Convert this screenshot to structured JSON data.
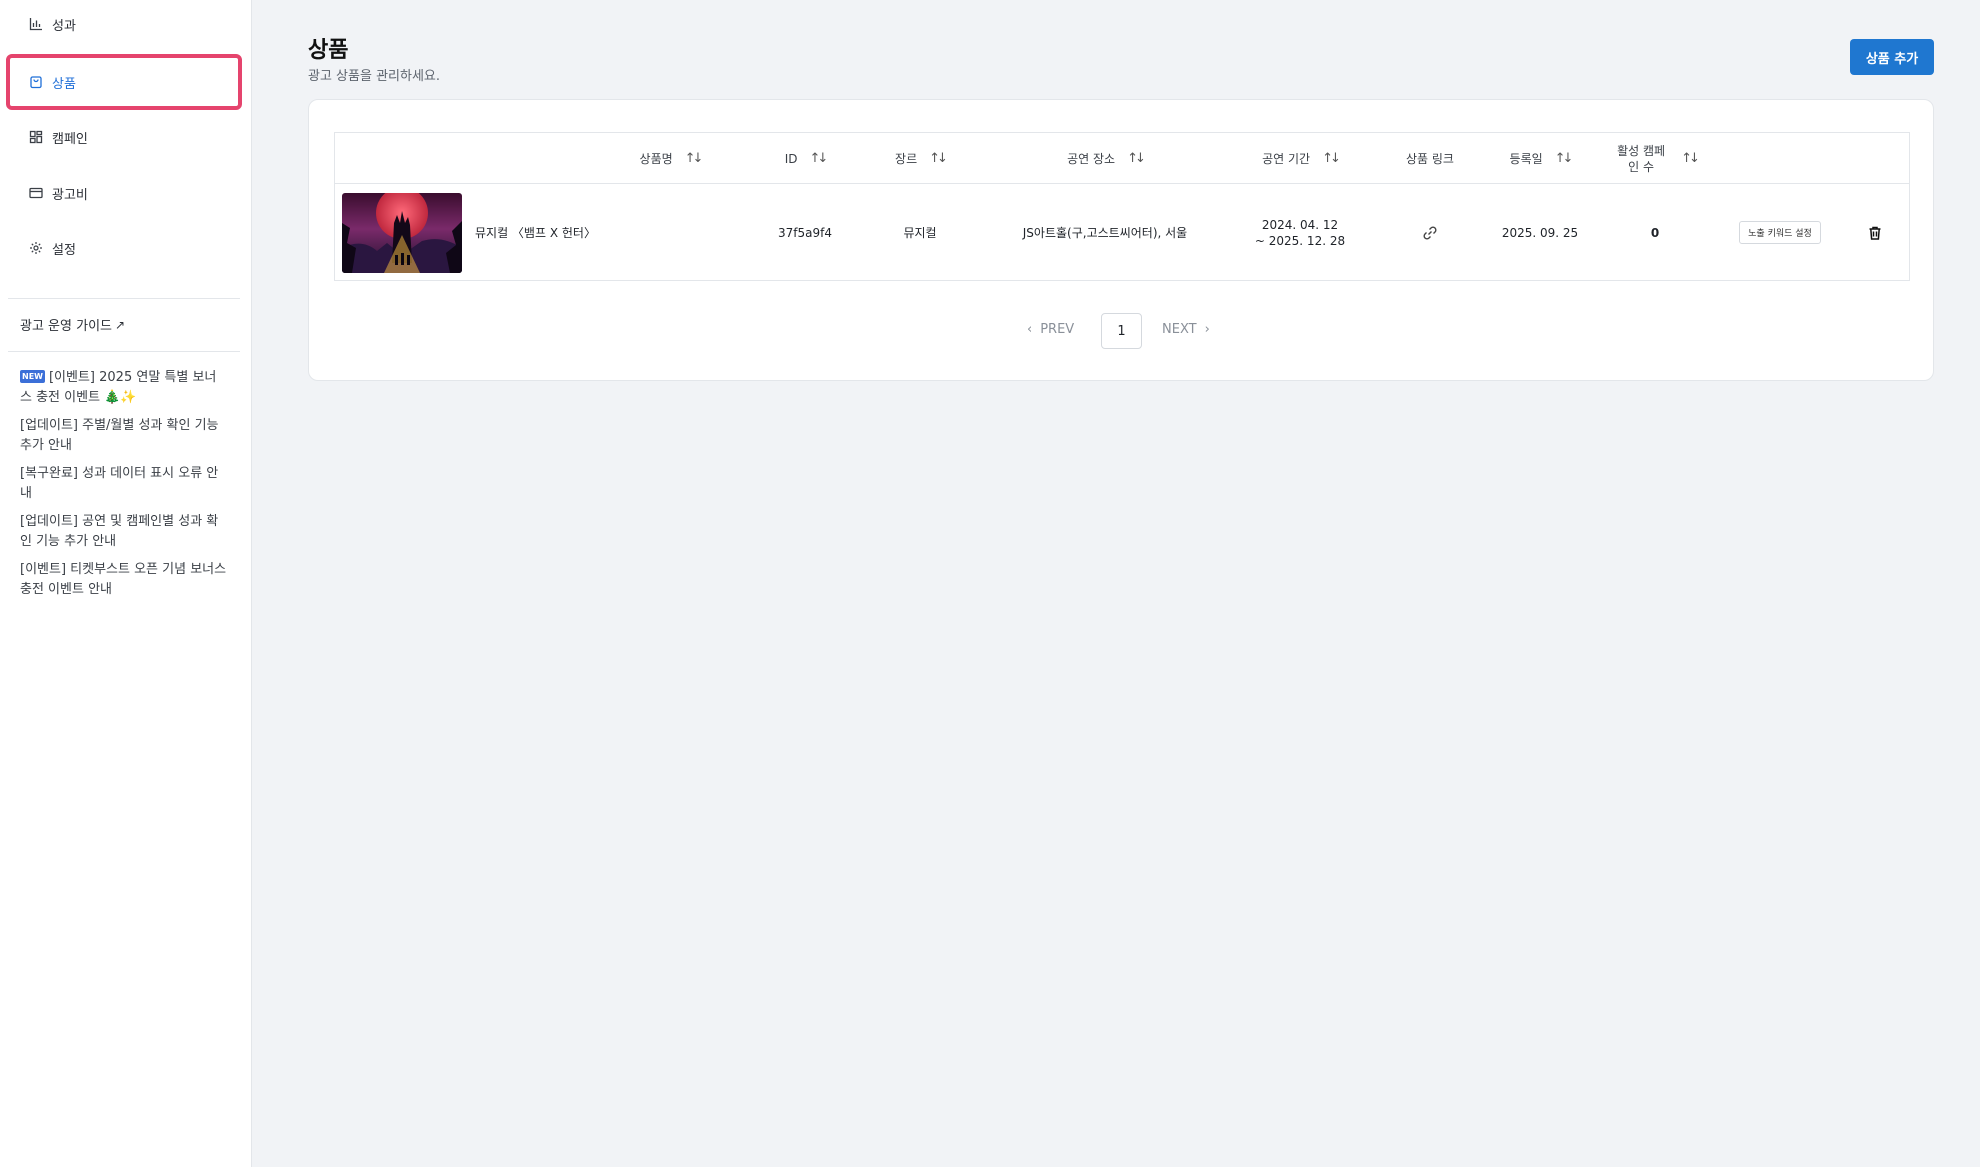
{
  "sidebar": {
    "items": [
      {
        "label": "성과",
        "icon": "bar-chart-icon"
      },
      {
        "label": "상품",
        "icon": "shopping-bag-icon",
        "active": true
      },
      {
        "label": "캠페인",
        "icon": "grid-icon"
      },
      {
        "label": "광고비",
        "icon": "credit-card-icon"
      },
      {
        "label": "설정",
        "icon": "gear-icon"
      }
    ],
    "guide_label": "광고 운영 가이드",
    "notices": [
      {
        "badge": "NEW",
        "text": "[이벤트] 2025 연말 특별 보너스 충전 이벤트 🎄✨"
      },
      {
        "text": "[업데이트] 주별/월별 성과 확인 기능 추가 안내"
      },
      {
        "text": "[복구완료] 성과 데이터 표시 오류 안내"
      },
      {
        "text": "[업데이트] 공연 및 캠페인별 성과 확인 기능 추가 안내"
      },
      {
        "text": "[이벤트] 티켓부스트 오픈 기념 보너스 충전 이벤트 안내"
      }
    ]
  },
  "header": {
    "title": "상품",
    "subtitle": "광고 상품을 관리하세요.",
    "add_button": "상품 추가"
  },
  "table": {
    "columns": [
      "상품명",
      "ID",
      "장르",
      "공연 장소",
      "공연 기간",
      "상품 링크",
      "등록일",
      "활성 캠페인 수"
    ],
    "rows": [
      {
        "name": "뮤지컬 〈뱀프 X 헌터〉",
        "id": "37f5a9f4",
        "genre": "뮤지컬",
        "venue": "JS아트홀(구,고스트씨어터), 서울",
        "period_start": "2024. 04. 12",
        "period_end": "~ 2025. 12. 28",
        "registered": "2025. 09. 25",
        "active_campaigns": "0",
        "keyword_button": "노출 키워드 설정"
      }
    ]
  },
  "pagination": {
    "prev": "PREV",
    "current": "1",
    "next": "NEXT"
  },
  "colors": {
    "accent": "#1f77d0",
    "active_nav": "#1f6fd8",
    "highlight_border": "#e5446d"
  }
}
